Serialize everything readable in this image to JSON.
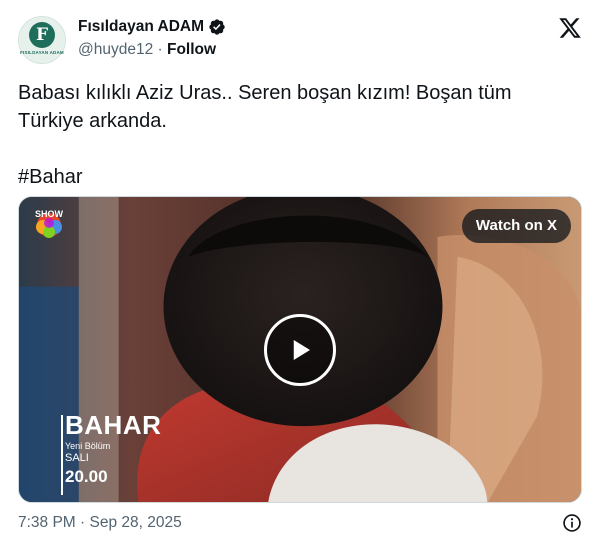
{
  "author": {
    "display_name": "Fısıldayan ADAM",
    "handle": "@huyde12",
    "separator": " · ",
    "follow_label": "Follow",
    "avatar_letter": "F",
    "avatar_caption": "FISILDAYAN ADAM",
    "verified_icon": "verified-badge-icon"
  },
  "tweet": {
    "text": "Babası kılıklı Aziz Uras.. Seren boşan kızım! Boşan tüm Türkiye arkanda.\n\n#Bahar",
    "timestamp": "7:38 PM · Sep 28, 2025"
  },
  "media": {
    "watch_label": "Watch on X",
    "channel_logo": "SHOW",
    "promo_title": "BAHAR",
    "promo_subtitle": "Yeni Bölüm",
    "promo_day": "SALI",
    "promo_time": "20.00"
  },
  "icons": {
    "brand": "x-logo-icon",
    "play": "play-icon",
    "info": "info-icon"
  },
  "colors": {
    "text": "#0f1419",
    "secondary": "#536471",
    "verified": "#0f1419",
    "brand_green": "#1f6d5b"
  }
}
